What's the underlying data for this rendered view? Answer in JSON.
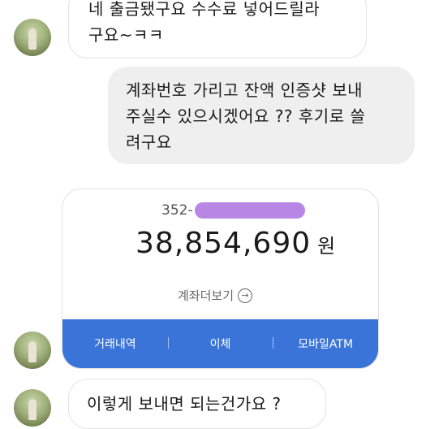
{
  "messages": [
    {
      "sender": "received",
      "lines": [
        "네 출금됐구요 수수료 넣어드릴라",
        "구요~ㅋㅋ"
      ]
    },
    {
      "sender": "sent",
      "lines": [
        "계좌번호 가리고 잔액 인증샷 보내",
        "주실수 있으시겠어요 ?? 후기로 쓸",
        "려구요"
      ]
    },
    {
      "sender": "received",
      "lines": [
        "이렇게 보내면 되는건가요 ?"
      ]
    }
  ],
  "bank_card": {
    "account_prefix": "352-",
    "balance": "38,854,690",
    "currency_unit": "원",
    "details_link": "계좌더보기",
    "tabs": [
      "거래내역",
      "이체",
      "모바일ATM"
    ],
    "accent_color": "#3a74d9",
    "mask_color": "#b887e6"
  },
  "icons": {
    "details_link": "circled-right-arrow-icon"
  }
}
